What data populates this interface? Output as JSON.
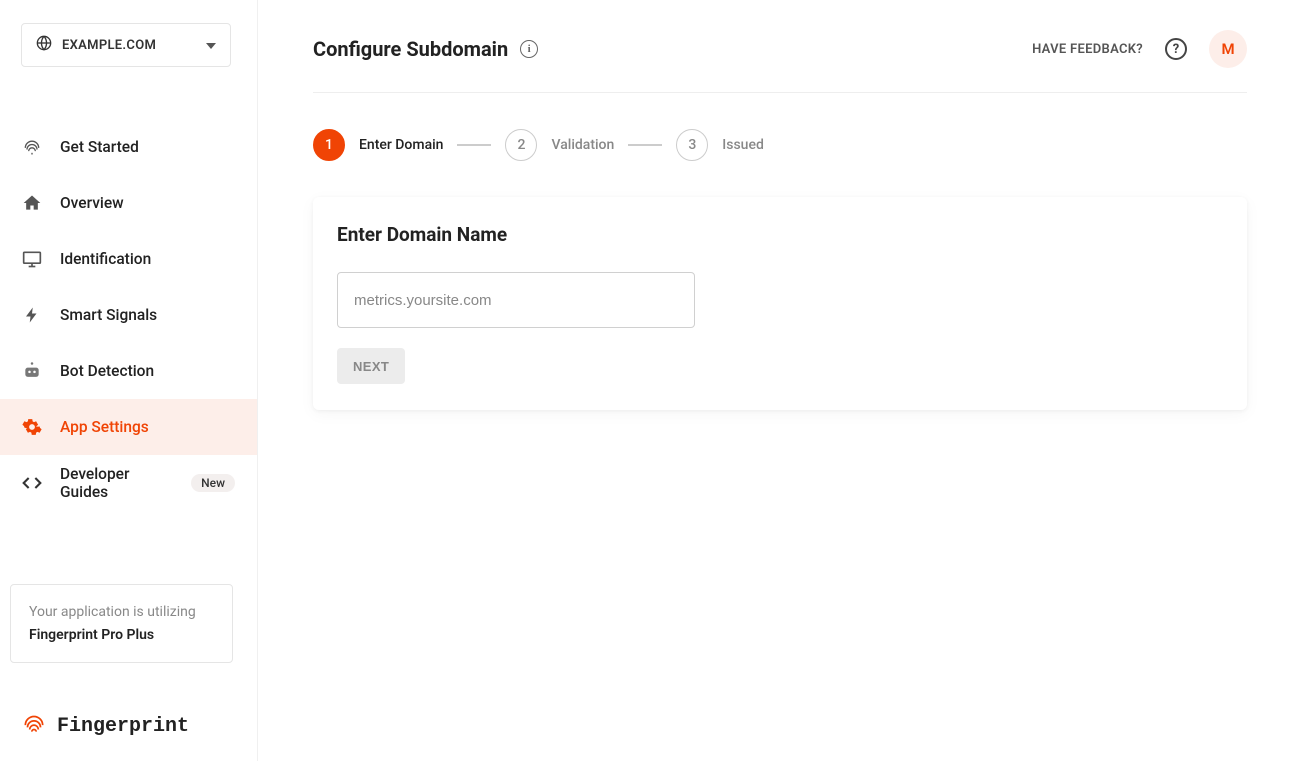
{
  "site_selector": {
    "label": "EXAMPLE.COM"
  },
  "sidebar": {
    "items": [
      {
        "label": "Get Started",
        "icon": "fingerprint-icon"
      },
      {
        "label": "Overview",
        "icon": "home-icon"
      },
      {
        "label": "Identification",
        "icon": "monitor-icon"
      },
      {
        "label": "Smart Signals",
        "icon": "bolt-icon"
      },
      {
        "label": "Bot Detection",
        "icon": "robot-icon"
      },
      {
        "label": "App Settings",
        "icon": "gear-icon",
        "active": true
      },
      {
        "label": "Developer Guides",
        "icon": "code-icon",
        "badge": "New"
      }
    ],
    "plan_line1": "Your application is utilizing",
    "plan_line2": "Fingerprint Pro Plus",
    "brand": "Fingerprint"
  },
  "header": {
    "title": "Configure Subdomain",
    "feedback_label": "HAVE FEEDBACK?",
    "avatar_initial": "M"
  },
  "stepper": {
    "steps": [
      {
        "num": "1",
        "label": "Enter Domain",
        "active": true
      },
      {
        "num": "2",
        "label": "Validation"
      },
      {
        "num": "3",
        "label": "Issued"
      }
    ]
  },
  "card": {
    "title": "Enter Domain Name",
    "input_placeholder": "metrics.yoursite.com",
    "next_label": "NEXT"
  }
}
